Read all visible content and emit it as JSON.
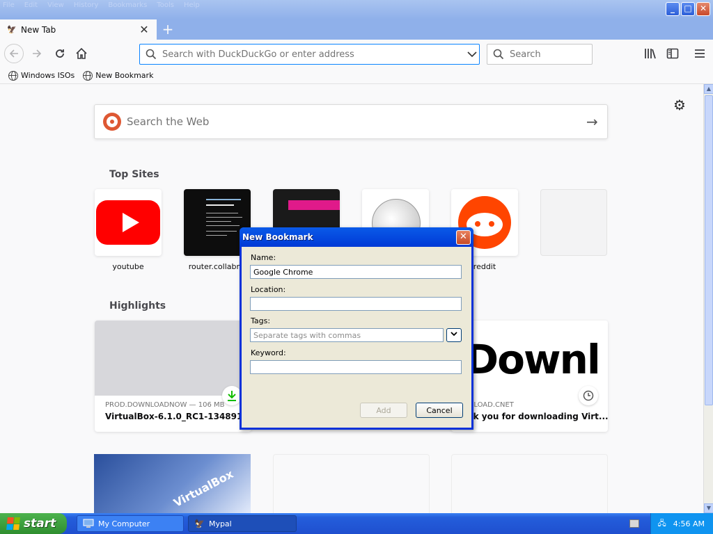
{
  "window": {
    "menu_items": [
      "File",
      "Edit",
      "View",
      "History",
      "Bookmarks",
      "Tools",
      "Help"
    ],
    "controls": {
      "minimize": "_",
      "maximize": "□",
      "close": "✕"
    }
  },
  "tabs": {
    "active_label": "New Tab",
    "close_glyph": "✕",
    "new_tab_glyph": "+"
  },
  "navbar": {
    "url_placeholder": "Search with DuckDuckGo or enter address",
    "search_placeholder": "Search"
  },
  "bookmarks_toolbar": [
    {
      "label": "Windows ISOs"
    },
    {
      "label": "New Bookmark"
    }
  ],
  "newtab": {
    "web_search_placeholder": "Search the Web",
    "top_sites_title": "Top Sites",
    "highlights_title": "Highlights",
    "top_sites": [
      {
        "label": "youtube"
      },
      {
        "label": "router.collabne"
      },
      {
        "label": ""
      },
      {
        "label": ""
      },
      {
        "label": "reddit"
      },
      {
        "label": ""
      }
    ],
    "highlights": [
      {
        "meta": "PROD.DOWNLOADNOW — 106 MB",
        "title": "VirtualBox-6.1.0_RC1-134891-..."
      },
      {
        "meta": "WNLOAD.CNET",
        "title": "ank you for downloading Virt..."
      }
    ],
    "highlight_image_text": "Downl",
    "tile_image_text": "VirtualBox"
  },
  "dialog": {
    "title": "New Bookmark",
    "name_label": "Name:",
    "name_value": "Google Chrome",
    "location_label": "Location:",
    "location_value": "",
    "tags_label": "Tags:",
    "tags_placeholder": "Separate tags with commas",
    "keyword_label": "Keyword:",
    "keyword_value": "",
    "add_button": "Add",
    "cancel_button": "Cancel"
  },
  "taskbar": {
    "start_label": "start",
    "tasks": [
      {
        "label": "My Computer"
      },
      {
        "label": "Mypal"
      }
    ],
    "clock": "4:56 AM"
  },
  "colors": {
    "accent": "#0a84ff",
    "xp_title_blue": "#0a5ae8",
    "taskbar_blue": "#245edb",
    "start_green": "#3ea23e"
  }
}
